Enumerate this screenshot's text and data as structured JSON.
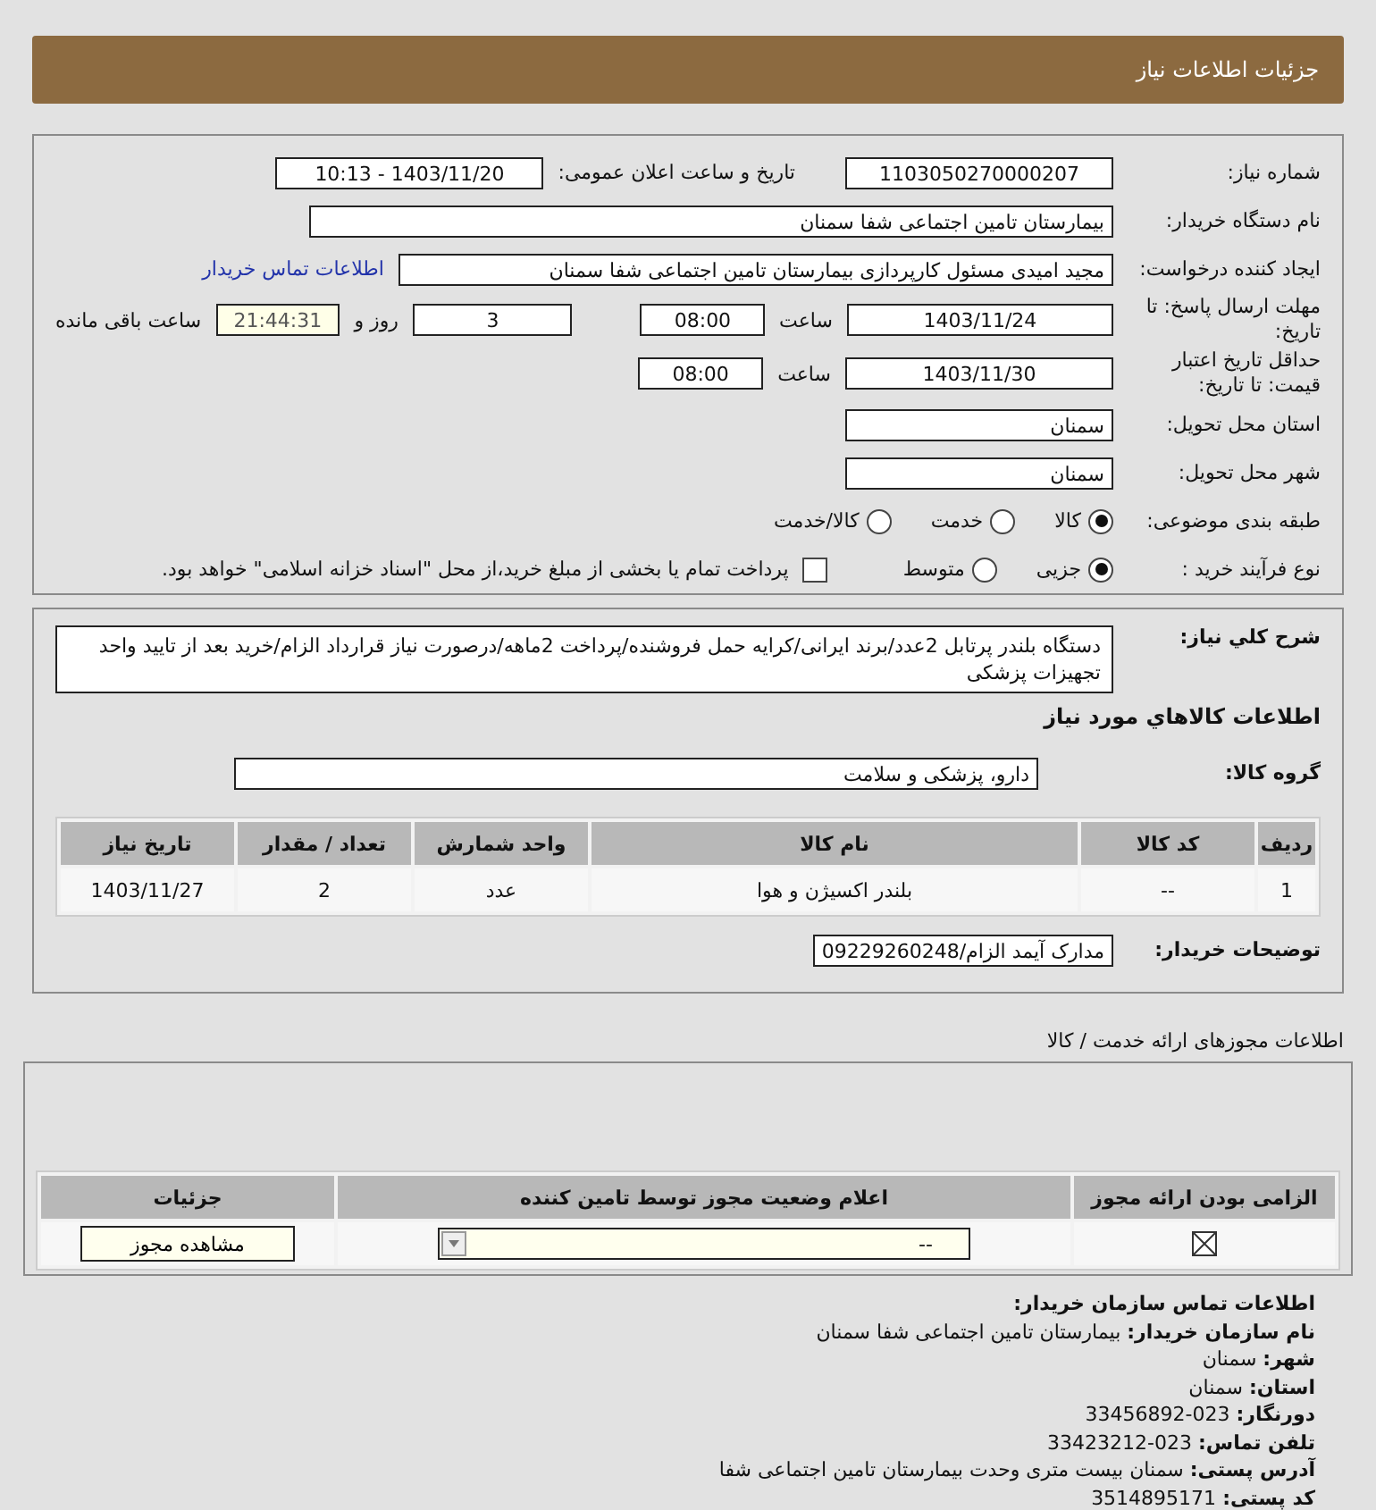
{
  "header": {
    "title": "جزئیات اطلاعات نیاز"
  },
  "need_number": {
    "label": "شماره نیاز:",
    "value": "1103050270000207"
  },
  "announce": {
    "label": "تاریخ و ساعت اعلان عمومی:",
    "value": "1403/11/20 - 10:13"
  },
  "buyer_org": {
    "label": "نام دستگاه خریدار:",
    "value": "بیمارستان تامین اجتماعی شفا سمنان"
  },
  "requester": {
    "label": "ایجاد کننده درخواست:",
    "value": "مجید امیدی مسئول کارپردازی بیمارستان تامین اجتماعی شفا سمنان",
    "link": "اطلاعات تماس خریدار"
  },
  "reply_deadline": {
    "label": "مهلت ارسال پاسخ: تا تاریخ:",
    "date": "1403/11/24",
    "time_label": "ساعت",
    "time": "08:00",
    "days": "3",
    "days_label": "روز و",
    "remaining": "21:44:31",
    "remaining_label": "ساعت باقی مانده"
  },
  "price_validity": {
    "label": "حداقل تاریخ اعتبار قیمت: تا تاریخ:",
    "date": "1403/11/30",
    "time_label": "ساعت",
    "time": "08:00"
  },
  "province": {
    "label": "استان محل تحویل:",
    "value": "سمنان"
  },
  "city": {
    "label": "شهر محل تحویل:",
    "value": "سمنان"
  },
  "category": {
    "label": "طبقه بندی موضوعی:",
    "options": [
      {
        "label": "کالا",
        "selected": true
      },
      {
        "label": "خدمت",
        "selected": false
      },
      {
        "label": "کالا/خدمت",
        "selected": false
      }
    ]
  },
  "process": {
    "label": "نوع فرآیند خرید :",
    "options": [
      {
        "label": "جزیی",
        "selected": true
      },
      {
        "label": "متوسط",
        "selected": false
      }
    ],
    "payment": {
      "checked": false,
      "label": "پرداخت تمام یا بخشی از مبلغ خرید،از محل \"اسناد خزانه اسلامی\" خواهد بود."
    }
  },
  "description": {
    "label": "شرح كلي نياز:",
    "value": "دستگاه بلندر پرتابل 2عدد/برند ایرانی/کرایه حمل فروشنده/پرداخت 2ماهه/درصورت نیاز قرارداد الزام/خرید بعد از تایید واحد تجهیزات پزشکی"
  },
  "items_title": "اطلاعات كالاهاي مورد نياز",
  "goods_group": {
    "label": "گروه کالا:",
    "value": "دارو، پزشکی و سلامت"
  },
  "items_table": {
    "columns": [
      "ردیف",
      "کد کالا",
      "نام کالا",
      "واحد شمارش",
      "تعداد / مقدار",
      "تاریخ نیاز"
    ],
    "rows": [
      [
        "1",
        "--",
        "بلندر اکسیژن و هوا",
        "عدد",
        "2",
        "1403/11/27"
      ]
    ]
  },
  "buyer_notes": {
    "label": "توضیحات خریدار:",
    "value": "مدارک آیمد الزام/09229260248"
  },
  "licenses_title": "اطلاعات مجوزهای ارائه خدمت / کالا",
  "licenses_table": {
    "columns": [
      "الزامی بودن ارائه مجوز",
      "اعلام وضعیت مجوز توسط تامین کننده",
      "جزئیات"
    ],
    "rows": [
      {
        "required": true,
        "status": "--",
        "button": "مشاهده مجوز"
      }
    ]
  },
  "contact": {
    "title": "اطلاعات تماس سازمان خریدار:",
    "lines": [
      "**نام سازمان خریدار:** بیمارستان تامین اجتماعی شفا سمنان",
      "**شهر:** سمنان",
      "**استان:** سمنان",
      "**دورنگار:** 023-33456892",
      "**تلفن تماس:** 023-33423212",
      "**آدرس پستی:** سمنان بیست متری وحدت بیمارستان تامین اجتماعی شفا",
      "**کد پستی:** 3514895171"
    ]
  }
}
